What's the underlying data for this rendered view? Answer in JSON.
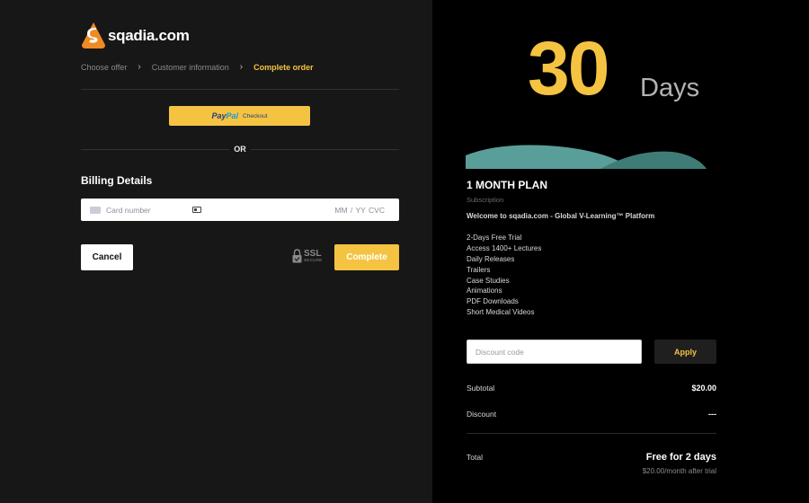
{
  "brand": {
    "name": "sqadia.com",
    "logo_icon": "sqadia-logo-icon",
    "accent": "#f5c342"
  },
  "breadcrumb": {
    "items": [
      {
        "label": "Choose offer"
      },
      {
        "label": "Customer information"
      },
      {
        "label": "Complete order"
      }
    ],
    "separator_icon": "chevron-right-icon"
  },
  "paypal": {
    "pay": "Pay",
    "pal": "Pal",
    "checkout": "Checkout"
  },
  "or_label": "OR",
  "billing": {
    "title": "Billing Details",
    "card_placeholder": "Card number",
    "expiry_cvc_placeholder": "MM / YY  CVC"
  },
  "actions": {
    "cancel": "Cancel",
    "complete": "Complete"
  },
  "ssl_badge": {
    "main": "SSL",
    "sub": "SECURE"
  },
  "plan": {
    "days_number": "30",
    "days_word": "Days",
    "title": "1 MONTH PLAN",
    "subtitle": "Subscription",
    "welcome": "Welcome to sqadia.com - Global V-Learning™ Platform",
    "features": [
      "2-Days Free Trial",
      "Access 1400+ Lectures",
      "Daily Releases",
      "Trailers",
      "Case Studies",
      "Animations",
      "PDF Downloads",
      "Short Medical Videos"
    ]
  },
  "discount": {
    "placeholder": "Discount code",
    "apply": "Apply"
  },
  "summary": {
    "subtotal_label": "Subtotal",
    "subtotal_value": "$20.00",
    "discount_label": "Discount",
    "discount_value": "---",
    "total_label": "Total",
    "total_value": "Free for 2 days",
    "total_note": "$20.00/month after trial"
  }
}
